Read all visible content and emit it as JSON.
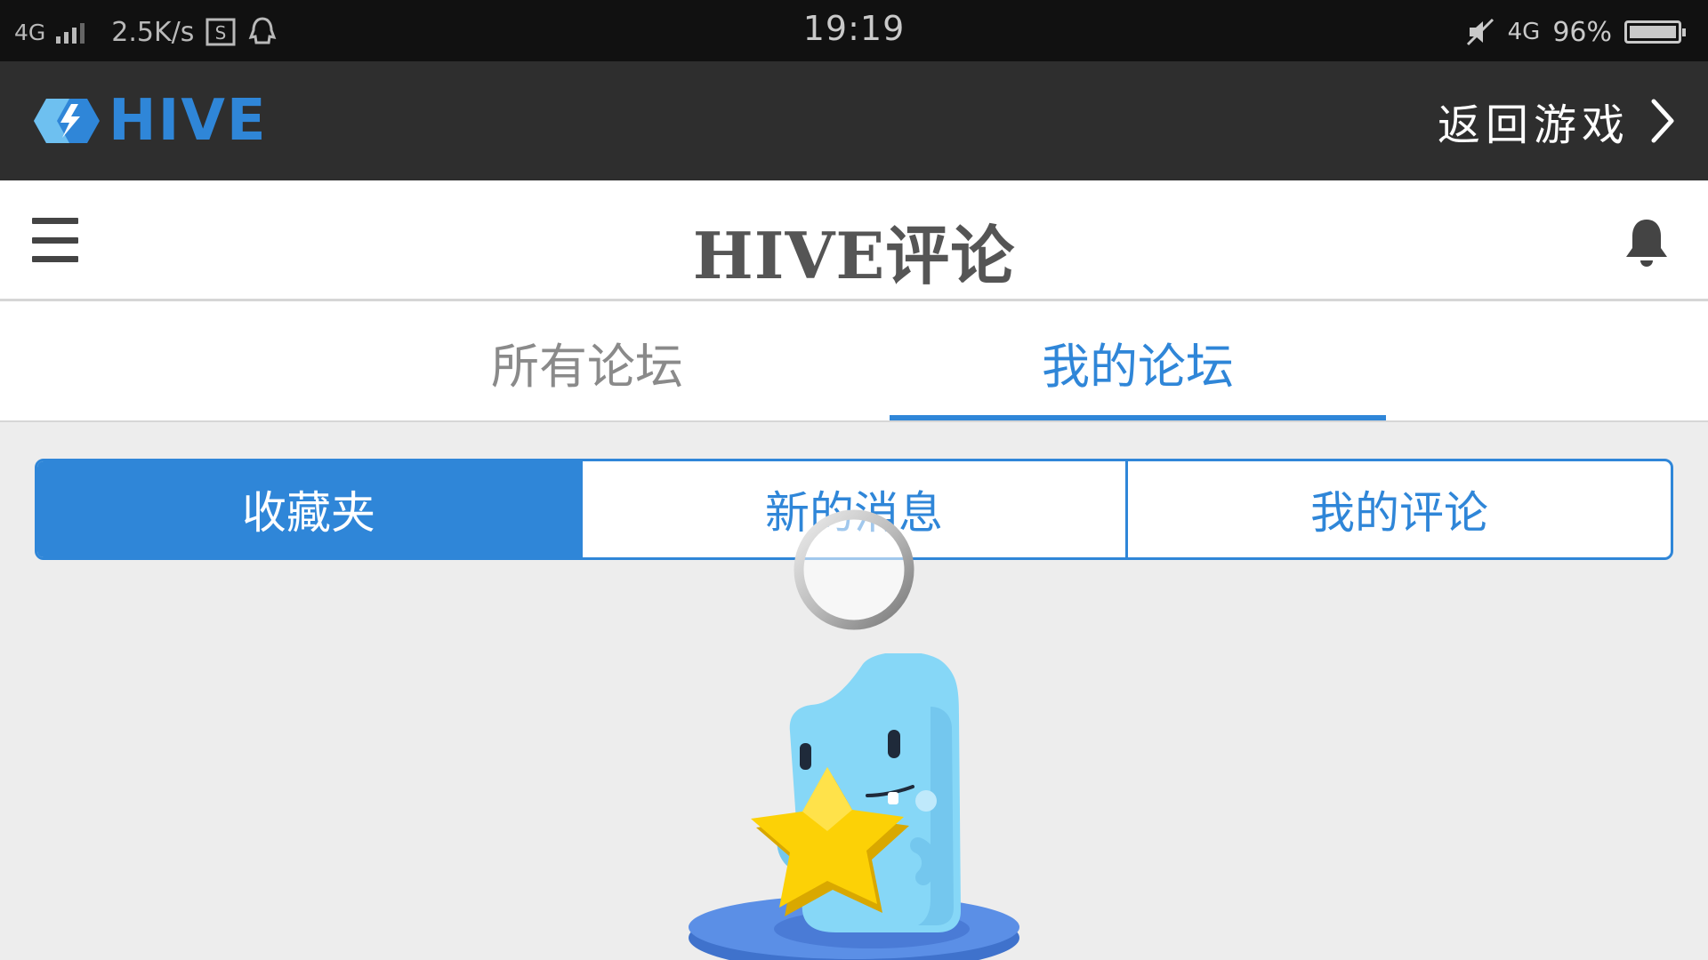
{
  "status_bar": {
    "network": "4G",
    "speed": "2.5K/s",
    "time": "19:19",
    "network_right": "4G",
    "battery": "96%"
  },
  "hive_header": {
    "brand": "HIVE",
    "back_label": "返回游戏"
  },
  "title_bar": {
    "title": "HIVE评论"
  },
  "tabs": [
    {
      "label": "所有论坛",
      "active": false
    },
    {
      "label": "我的论坛",
      "active": true
    }
  ],
  "segments": [
    {
      "label": "收藏夹",
      "active": true
    },
    {
      "label": "新的消息",
      "active": false
    },
    {
      "label": "我的评论",
      "active": false
    }
  ],
  "colors": {
    "accent": "#2f86d8",
    "header_bg": "#2e2e2e",
    "status_bg": "#111111",
    "content_bg": "#ededed"
  },
  "icons": {
    "menu": "menu-icon",
    "bell": "bell-icon",
    "back": "chevron-right-icon",
    "spinner": "loading-spinner",
    "mascot": "mascot-illustration"
  }
}
